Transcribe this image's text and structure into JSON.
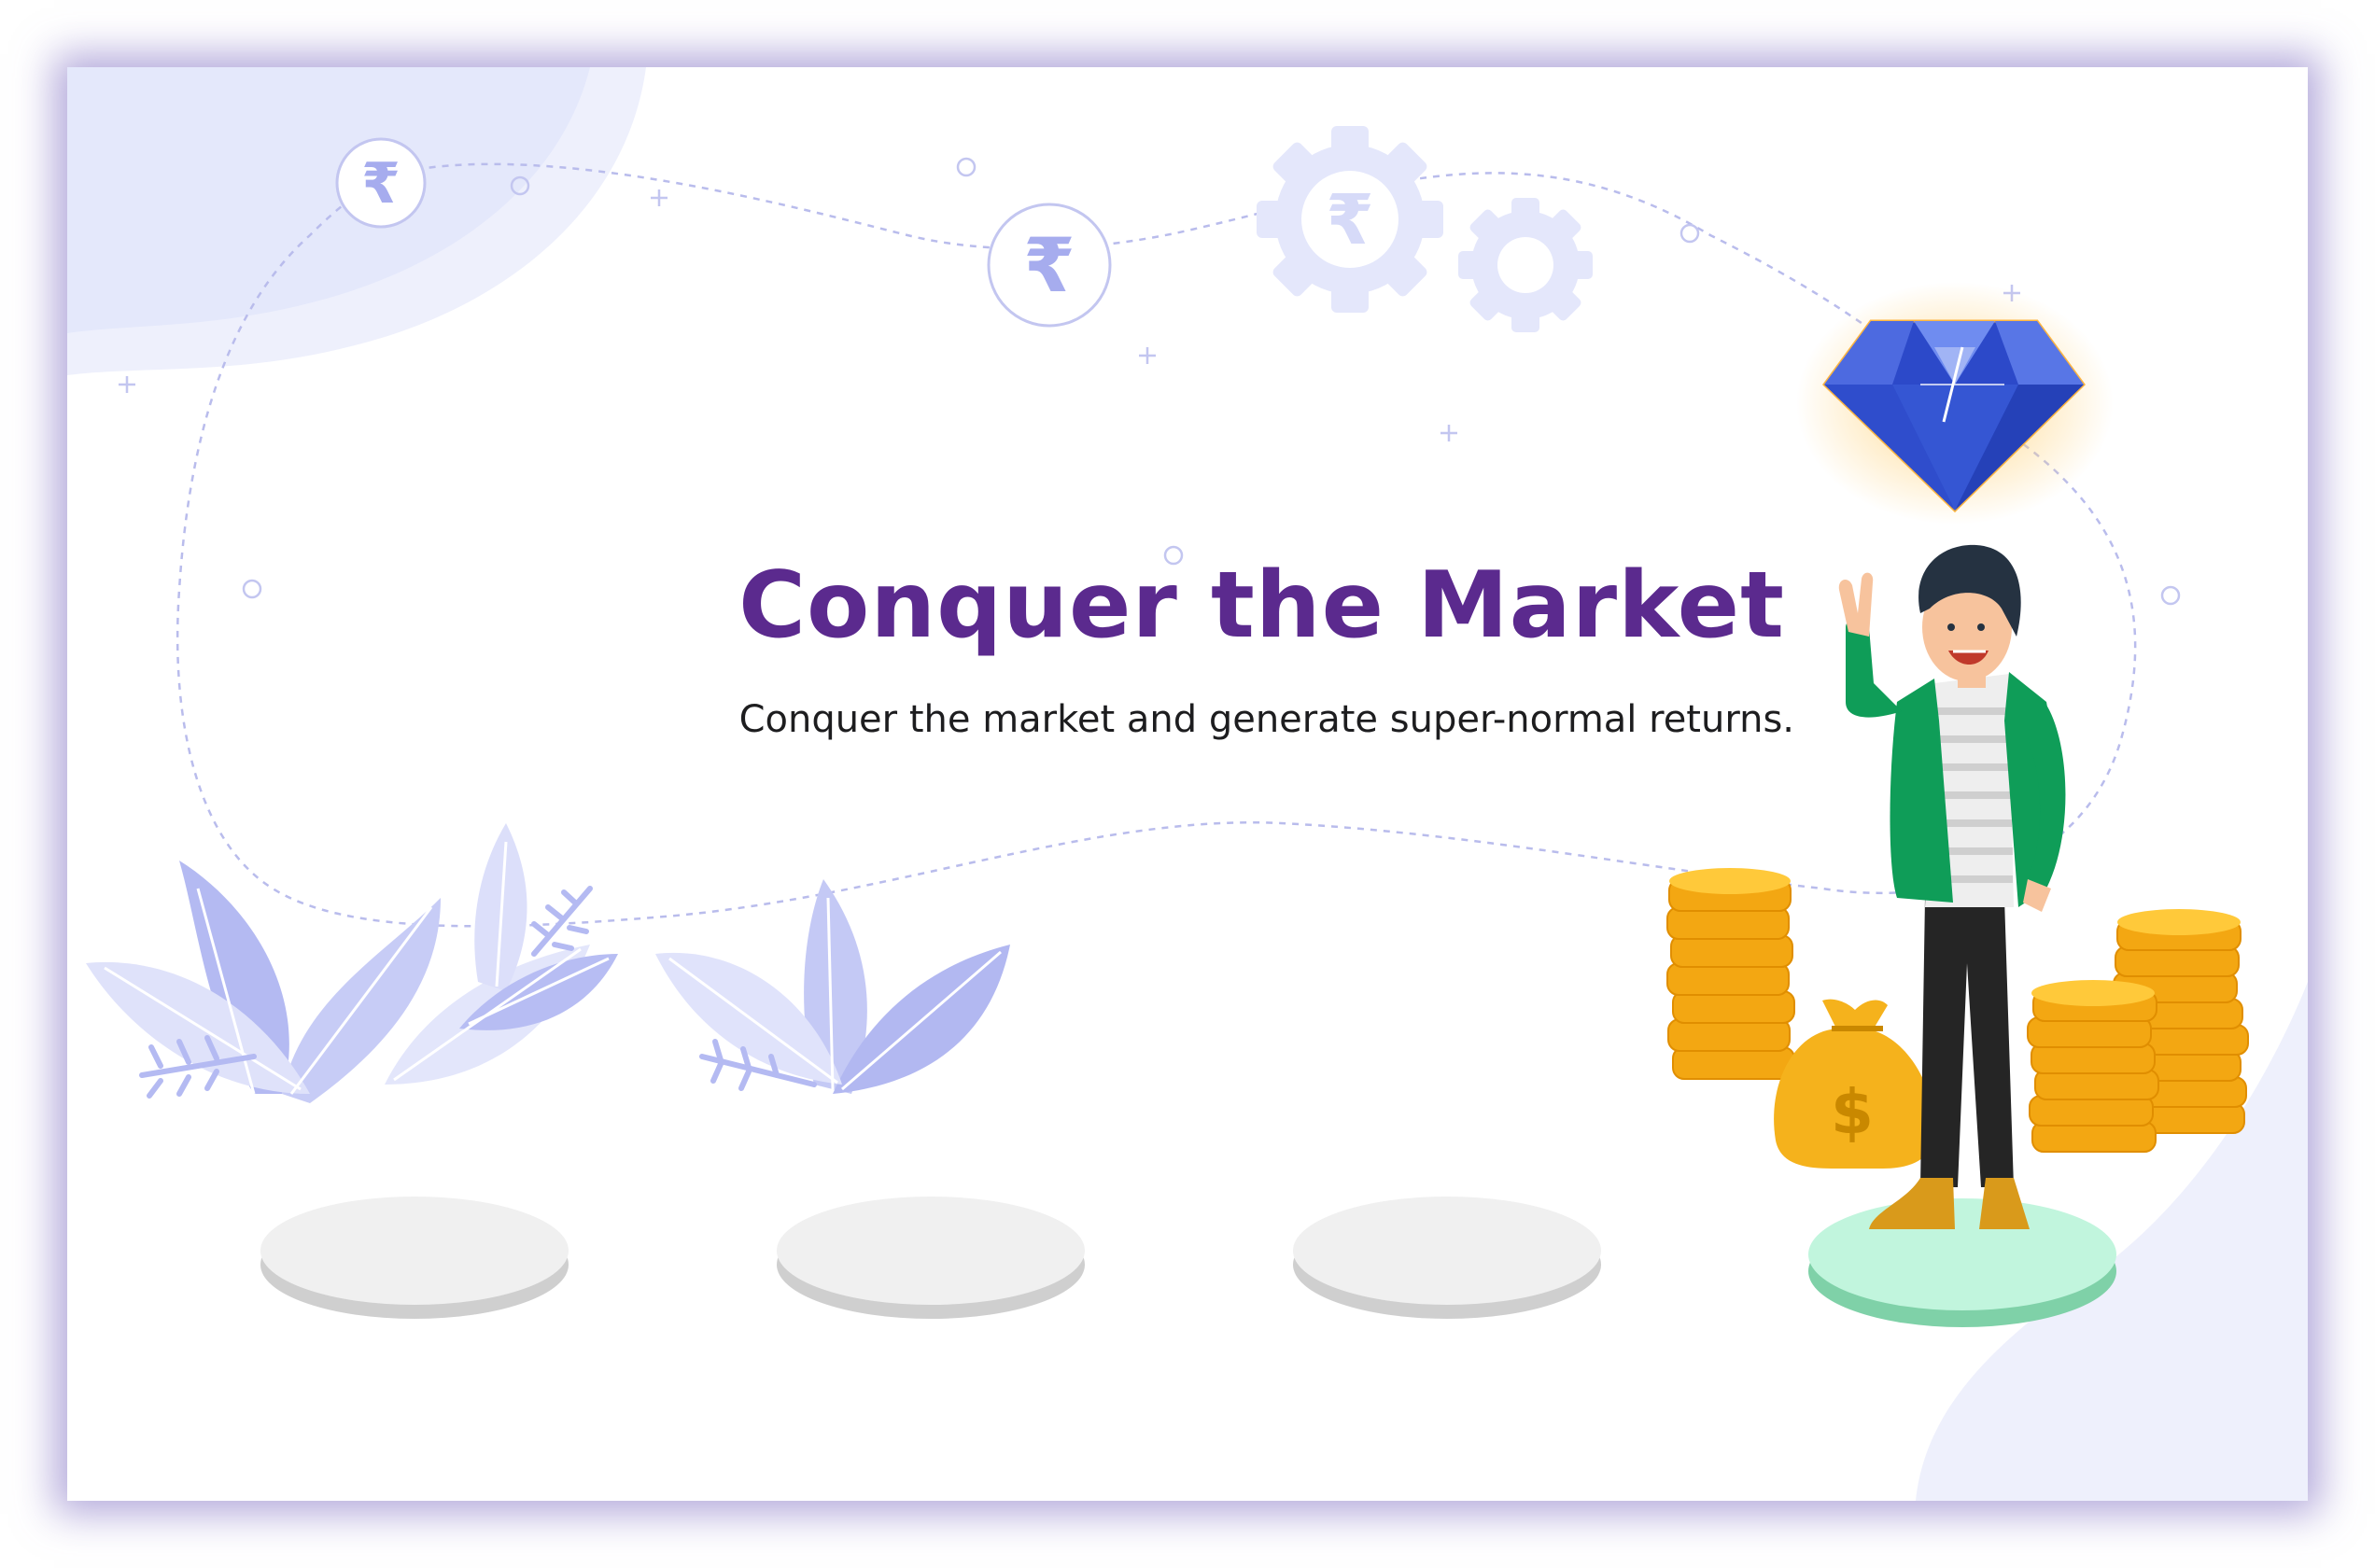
{
  "slide": {
    "title": "Conquer the Market",
    "subtitle": "Conquer the market and generate super-normal returns."
  },
  "icons": {
    "currency_symbol": "₹",
    "bag_symbol": "$"
  },
  "colors": {
    "title": "#5b2a8e",
    "text": "#1d1d1f",
    "accent_light": "#e4e7fb",
    "leaf": "#a9b0f0",
    "coin": "#f5b21c",
    "jacket": "#0f9d58",
    "diamond": "#3a56d6",
    "pedestal_active": "#bff5dc",
    "pedestal_idle": "#eeeeee"
  }
}
